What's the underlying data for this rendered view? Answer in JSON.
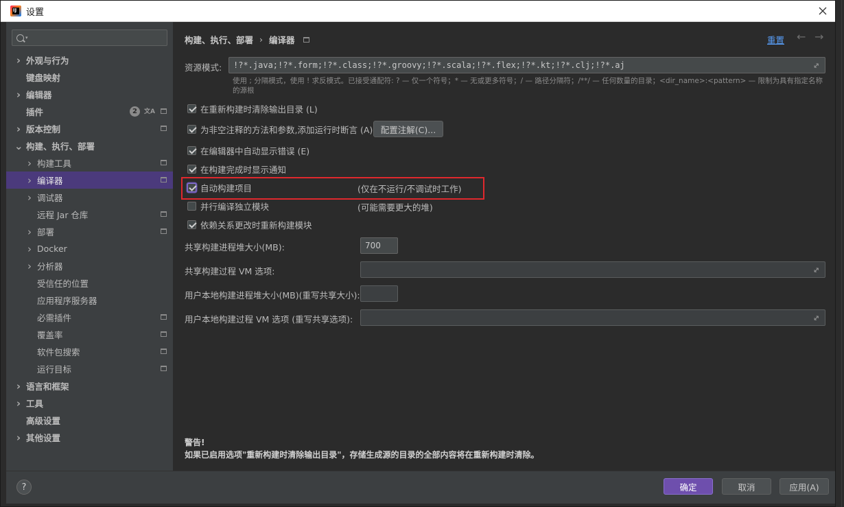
{
  "window": {
    "title": "设置",
    "app_icon_glyph": "IJ"
  },
  "search": {
    "placeholder": ""
  },
  "sidebar": {
    "items": [
      {
        "label": "外观与行为",
        "level": 0,
        "chevron": ">",
        "bold": true
      },
      {
        "label": "键盘映射",
        "level": 0,
        "chevron": "",
        "bold": true
      },
      {
        "label": "编辑器",
        "level": 0,
        "chevron": ">",
        "bold": true
      },
      {
        "label": "插件",
        "level": 0,
        "chevron": "",
        "bold": true,
        "badge": "2"
      },
      {
        "label": "版本控制",
        "level": 0,
        "chevron": ">",
        "bold": true
      },
      {
        "label": "构建、执行、部署",
        "level": 0,
        "chevron": "v",
        "bold": true
      },
      {
        "label": "构建工具",
        "level": 1,
        "chevron": ">"
      },
      {
        "label": "编译器",
        "level": 1,
        "chevron": ">",
        "selected": true
      },
      {
        "label": "调试器",
        "level": 1,
        "chevron": ">"
      },
      {
        "label": "远程 Jar 仓库",
        "level": 1,
        "chevron": ""
      },
      {
        "label": "部署",
        "level": 1,
        "chevron": ">"
      },
      {
        "label": "Docker",
        "level": 1,
        "chevron": ">"
      },
      {
        "label": "分析器",
        "level": 1,
        "chevron": ">"
      },
      {
        "label": "受信任的位置",
        "level": 1,
        "chevron": ""
      },
      {
        "label": "应用程序服务器",
        "level": 1,
        "chevron": ""
      },
      {
        "label": "必需插件",
        "level": 1,
        "chevron": ""
      },
      {
        "label": "覆盖率",
        "level": 1,
        "chevron": ""
      },
      {
        "label": "软件包搜索",
        "level": 1,
        "chevron": ""
      },
      {
        "label": "运行目标",
        "level": 1,
        "chevron": ""
      },
      {
        "label": "语言和框架",
        "level": 0,
        "chevron": ">",
        "bold": true
      },
      {
        "label": "工具",
        "level": 0,
        "chevron": ">",
        "bold": true
      },
      {
        "label": "高级设置",
        "level": 0,
        "chevron": "",
        "bold": true
      },
      {
        "label": "其他设置",
        "level": 0,
        "chevron": ">",
        "bold": true
      }
    ]
  },
  "header": {
    "breadcrumb_parent": "构建、执行、部署",
    "breadcrumb_sep": "›",
    "breadcrumb_current": "编译器",
    "reset_label": "重置",
    "back_glyph": "←",
    "forward_glyph": "→"
  },
  "resource": {
    "label": "资源模式:",
    "value": "!?*.java;!?*.form;!?*.class;!?*.groovy;!?*.scala;!?*.flex;!?*.kt;!?*.clj;!?*.aj",
    "hint": "使用 ; 分隔模式，使用 ! 求反模式。已接受通配符: ? — 仅一个符号；* — 无或更多符号；/ — 路径分隔符；/**/ — 任何数量的目录；<dir_name>:<pattern> — 限制为具有指定名称的源根"
  },
  "options": {
    "clear_output": {
      "label": "在重新构建时清除输出目录 (L)",
      "checked": true
    },
    "add_assertions": {
      "label": "为非空注释的方法和参数,添加运行时断言 (A)",
      "checked": true
    },
    "config_annotations_label": "配置注解(C)...",
    "auto_show_errors": {
      "label": "在编辑器中自动显示错误 (E)",
      "checked": true
    },
    "show_notification": {
      "label": "在构建完成时显示通知",
      "checked": true
    },
    "auto_build": {
      "label": "自动构建项目",
      "checked": true,
      "note": "(仅在不运行/不调试时工作)"
    },
    "parallel_compile": {
      "label": "并行编译独立模块",
      "checked": false,
      "note": "(可能需要更大的堆)"
    },
    "rebuild_on_deps": {
      "label": "依赖关系更改时重新构建模块",
      "checked": true
    }
  },
  "fields": {
    "heap_size": {
      "label": "共享构建进程堆大小(MB):",
      "value": "700"
    },
    "vm_options": {
      "label": "共享构建过程 VM 选项:",
      "value": ""
    },
    "user_heap": {
      "label": "用户本地构建进程堆大小(MB)(重写共享大小):",
      "value": ""
    },
    "user_vm": {
      "label": "用户本地构建过程 VM 选项 (重写共享选项):",
      "value": ""
    }
  },
  "warning": {
    "title": "警告!",
    "text": "如果已启用选项\"重新构建时清除输出目录\"，存储生成源的目录的全部内容将在重新构建时清除。"
  },
  "footer": {
    "help_glyph": "?",
    "ok_label": "确定",
    "cancel_label": "取消",
    "apply_label": "应用(A)"
  },
  "colors": {
    "accent": "#6e4fad",
    "selection": "#4b3a7c",
    "link": "#589df6",
    "highlight_box": "#e0282d"
  }
}
